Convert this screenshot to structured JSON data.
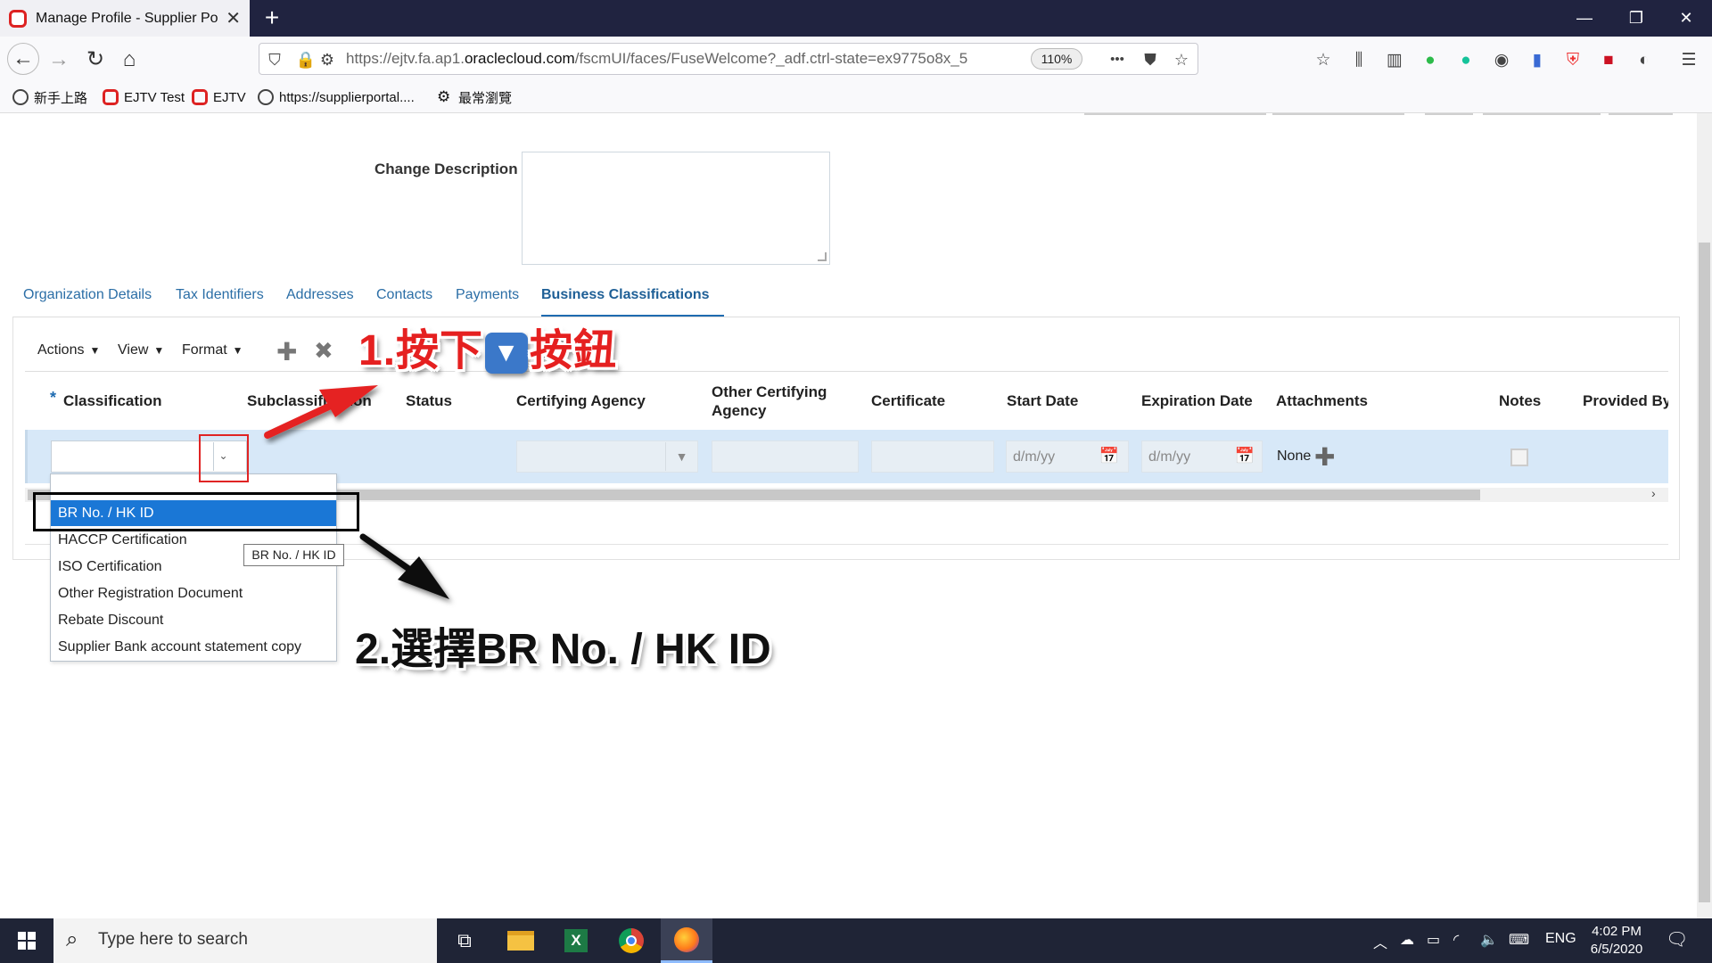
{
  "browser": {
    "tab_title": "Manage Profile - Supplier Porta",
    "close_glyph": "✕",
    "new_tab_glyph": "+",
    "window_controls": [
      "—",
      "❐",
      "✕"
    ],
    "url_prefix": "https://ejtv.fa.ap1.",
    "url_domain": "oraclecloud.com",
    "url_suffix": "/fscmUI/faces/FuseWelcome?_adf.ctrl-state=ex9775o8x_5",
    "zoom": "110%",
    "more_glyph": "•••",
    "bookmarks": [
      "新手上路",
      "EJTV Test",
      "EJTV",
      "https://supplierportal....",
      "最常瀏覽"
    ]
  },
  "form": {
    "change_description_label": "Change Description",
    "change_description_value": ""
  },
  "tabs": [
    {
      "label": "Organization Details",
      "active": false
    },
    {
      "label": "Tax Identifiers",
      "active": false
    },
    {
      "label": "Addresses",
      "active": false
    },
    {
      "label": "Contacts",
      "active": false
    },
    {
      "label": "Payments",
      "active": false
    },
    {
      "label": "Business Classifications",
      "active": true
    }
  ],
  "toolbar": {
    "actions_label": "Actions",
    "view_label": "View",
    "format_label": "Format",
    "add_glyph": "✚",
    "delete_glyph": "✖"
  },
  "table": {
    "required_marker": "*",
    "columns": [
      "Classification",
      "Subclassification",
      "Status",
      "Certifying Agency",
      "Other Certifying Agency",
      "Certificate",
      "Start Date",
      "Expiration Date",
      "Attachments",
      "Notes",
      "Provided By"
    ],
    "row": {
      "classification": "",
      "start_date_placeholder": "d/m/yy",
      "expiration_date_placeholder": "d/m/yy",
      "attachments": "None"
    }
  },
  "dropdown": {
    "options": [
      "",
      "BR No. / HK ID",
      "HACCP Certification",
      "ISO Certification",
      "Other Registration Document",
      "Rebate Discount",
      "Supplier Bank account statement copy"
    ],
    "selected_index": 1,
    "tooltip": "BR No. / HK ID"
  },
  "annotations": {
    "step1_prefix": "1.按下",
    "step1_key": "🔽",
    "step1_suffix": "按鈕",
    "step2": "2.選擇BR No. / HK ID"
  },
  "taskbar": {
    "search_placeholder": "Type here to search",
    "language": "ENG",
    "time": "4:02 PM",
    "date": "6/5/2020"
  },
  "colors": {
    "accent": "#1e6bb0",
    "selected_option": "#1a77d6",
    "row_highlight": "#d7e8f8",
    "annotation_red": "#e52020"
  }
}
